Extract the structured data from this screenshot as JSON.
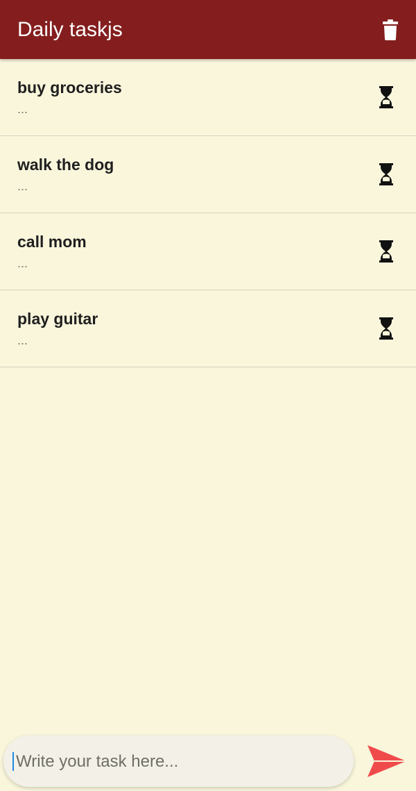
{
  "appbar": {
    "title": "Daily taskjs",
    "delete_icon": "trash-icon"
  },
  "tasks": [
    {
      "title": "buy groceries",
      "subtitle": "...",
      "status_icon": "hourglass-icon"
    },
    {
      "title": "walk the dog",
      "subtitle": "...",
      "status_icon": "hourglass-icon"
    },
    {
      "title": "call mom",
      "subtitle": "...",
      "status_icon": "hourglass-icon"
    },
    {
      "title": "play guitar",
      "subtitle": "...",
      "status_icon": "hourglass-icon"
    }
  ],
  "composer": {
    "placeholder": "Write your task here...",
    "value": "",
    "send_icon": "send-icon"
  },
  "colors": {
    "appbar": "#841E1E",
    "background": "#F9F6DC",
    "send_accent": "#F04B4B"
  }
}
